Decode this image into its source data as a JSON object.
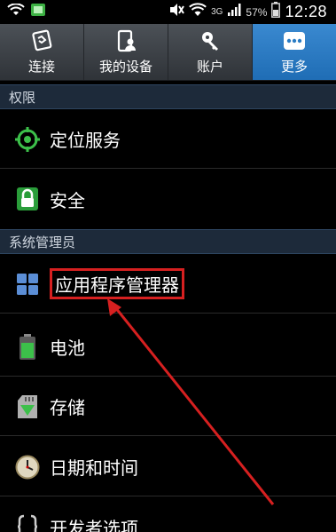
{
  "statusbar": {
    "network_type": "3G",
    "battery_percent": "57%",
    "time": "12:28",
    "icons": [
      "wifi-icon",
      "gallery-icon",
      "mute-icon",
      "wifi-icon",
      "signal-icon",
      "battery-icon"
    ]
  },
  "tabs": [
    {
      "label": "连接",
      "icon": "connections-icon",
      "active": false
    },
    {
      "label": "我的设备",
      "icon": "my-device-icon",
      "active": false
    },
    {
      "label": "账户",
      "icon": "accounts-icon",
      "active": false
    },
    {
      "label": "更多",
      "icon": "more-icon",
      "active": true
    }
  ],
  "sections": [
    {
      "header": "权限",
      "items": [
        {
          "label": "定位服务",
          "icon": "location-icon"
        },
        {
          "label": "安全",
          "icon": "lock-icon"
        }
      ]
    },
    {
      "header": "系统管理员",
      "items": [
        {
          "label": "应用程序管理器",
          "icon": "app-grid-icon",
          "highlighted": true
        },
        {
          "label": "电池",
          "icon": "battery-icon"
        },
        {
          "label": "存储",
          "icon": "storage-icon"
        },
        {
          "label": "日期和时间",
          "icon": "clock-icon"
        },
        {
          "label": "开发者选项",
          "icon": "developer-icon"
        }
      ]
    }
  ],
  "colors": {
    "active_tab": "#2a7cc4",
    "highlight_border": "#d62020",
    "arrow": "#d62020"
  }
}
